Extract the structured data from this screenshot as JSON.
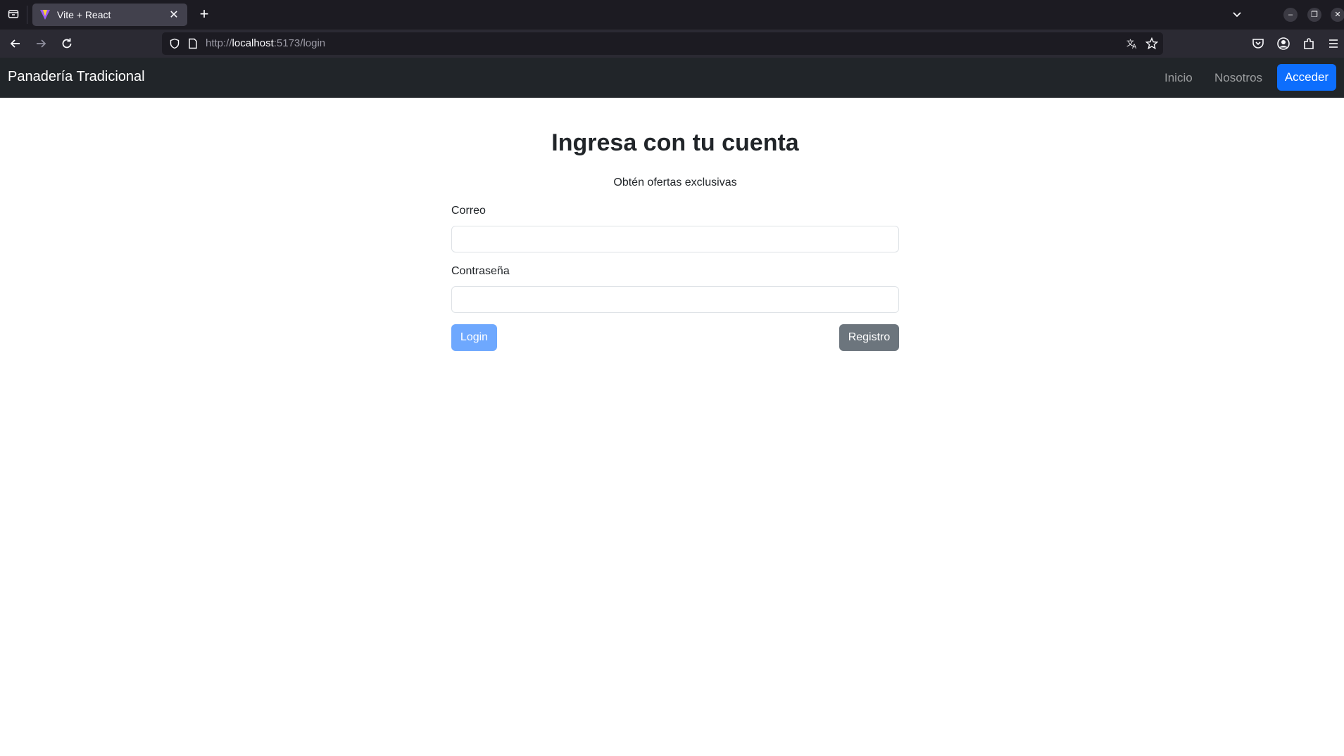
{
  "browser": {
    "tab_title": "Vite + React",
    "url_scheme": "http://",
    "url_host": "localhost",
    "url_rest": ":5173/login"
  },
  "site": {
    "brand": "Panadería Tradicional",
    "nav": {
      "inicio": "Inicio",
      "nosotros": "Nosotros",
      "acceder": "Acceder"
    }
  },
  "login": {
    "title": "Ingresa con tu cuenta",
    "subtitle": "Obtén ofertas exclusivas",
    "email_label": "Correo",
    "email_value": "",
    "password_label": "Contraseña",
    "password_value": "",
    "login_button": "Login",
    "register_button": "Registro"
  },
  "colors": {
    "navbar_bg": "#212529",
    "primary": "#0d6efd",
    "primary_disabled": "#6ea8fe",
    "secondary": "#6c757d"
  }
}
